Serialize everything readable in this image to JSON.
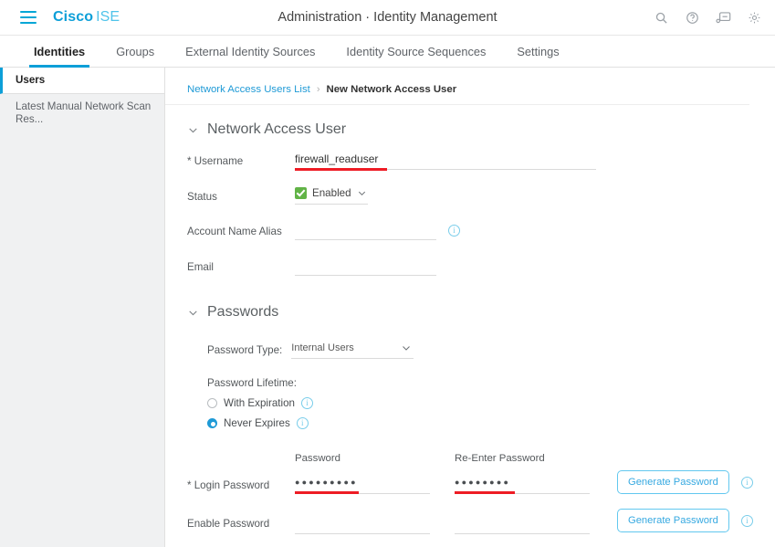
{
  "header": {
    "menu_icon": "hamburger-menu-icon",
    "brand_primary": "Cisco",
    "brand_secondary": "ISE",
    "title": "Administration · Identity Management",
    "icons": [
      {
        "name": "search-icon",
        "label": "Search"
      },
      {
        "name": "help-icon",
        "label": "Help"
      },
      {
        "name": "feedback-icon",
        "label": "Feedback"
      },
      {
        "name": "gear-icon",
        "label": "Settings"
      }
    ],
    "accent_blue": "#0d9fd8"
  },
  "tabs": [
    {
      "label": "Identities",
      "active": true
    },
    {
      "label": "Groups",
      "active": false
    },
    {
      "label": "External Identity Sources",
      "active": false
    },
    {
      "label": "Identity Source Sequences",
      "active": false
    },
    {
      "label": "Settings",
      "active": false
    }
  ],
  "sidebar": {
    "items": [
      {
        "label": "Users",
        "active": true
      },
      {
        "label": "Latest Manual Network Scan Res...",
        "active": false
      }
    ]
  },
  "breadcrumb": {
    "link": "Network Access Users List",
    "separator": "›",
    "current": "New Network Access User"
  },
  "network_access_user": {
    "section_title": "Network Access User",
    "username": {
      "label": "* Username",
      "value": "firewall_readuser",
      "annotated": true
    },
    "status": {
      "label": "Status",
      "value": "Enabled",
      "checkbox_color": "#61b346"
    },
    "account_name_alias": {
      "label": "Account Name Alias",
      "value": "",
      "info": "info-icon"
    },
    "email": {
      "label": "Email",
      "value": ""
    }
  },
  "passwords": {
    "section_title": "Passwords",
    "password_type": {
      "label": "Password Type:",
      "value": "Internal Users"
    },
    "lifetime": {
      "title": "Password Lifetime:",
      "options": [
        {
          "label": "With Expiration",
          "selected": false
        },
        {
          "label": "Never Expires",
          "selected": true
        }
      ]
    },
    "columns": {
      "password": "Password",
      "reenter": "Re-Enter Password"
    },
    "rows": [
      {
        "label": "* Login Password",
        "password_value": "●●●●●●●●●",
        "reenter_value": "●●●●●●●●",
        "button": "Generate Password",
        "annotated": true
      },
      {
        "label": "Enable Password",
        "password_value": "",
        "reenter_value": "",
        "button": "Generate Password",
        "annotated": false
      }
    ]
  },
  "annotation_color": "#ee1c25"
}
